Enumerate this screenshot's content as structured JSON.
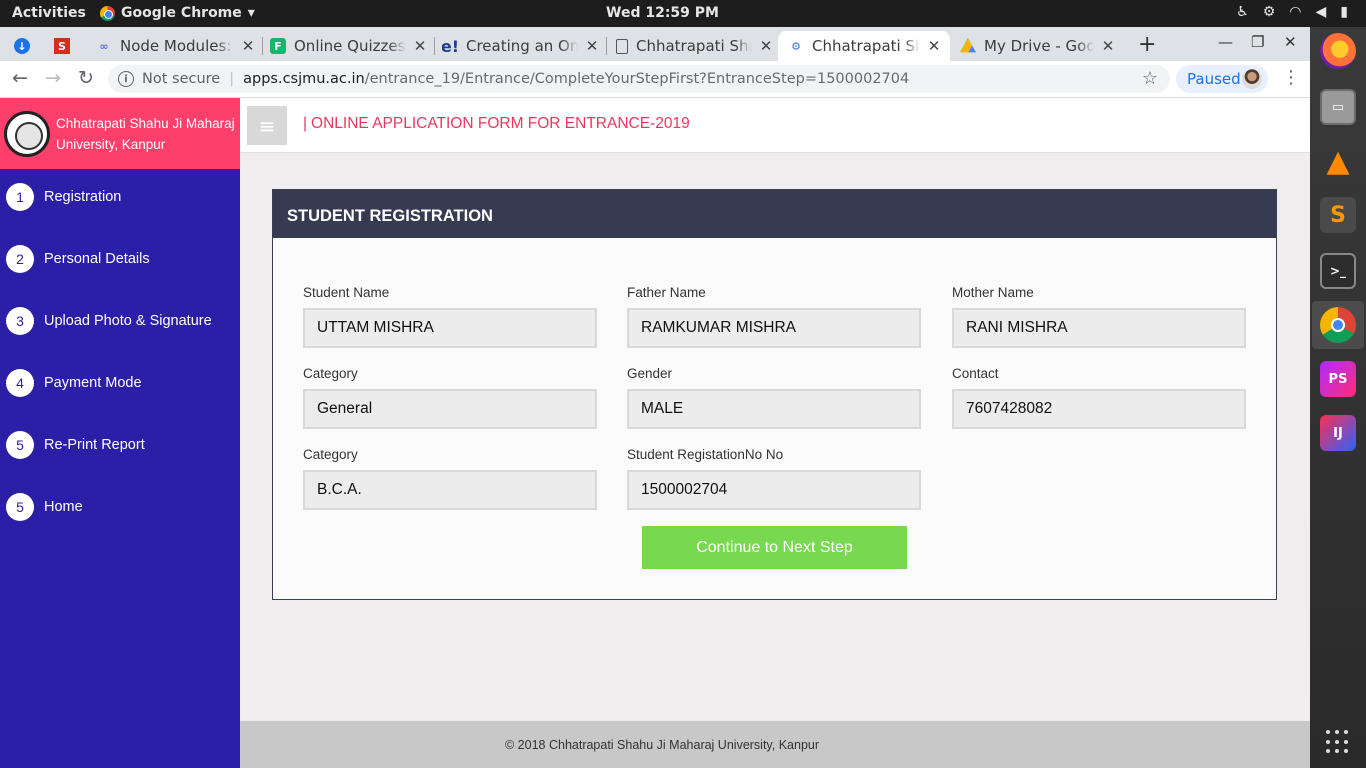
{
  "system": {
    "activities": "Activities",
    "app_name": "Google Chrome",
    "clock": "Wed 12:59 PM"
  },
  "tabs": [
    {
      "label": "",
      "icon": "download-icon"
    },
    {
      "label": "",
      "icon": "s-logo-icon"
    },
    {
      "label": "Node Modules: C",
      "icon": "link-icon"
    },
    {
      "label": "Online Quizzes |",
      "icon": "quiz-icon"
    },
    {
      "label": "Creating an Onl",
      "icon": "e-logo-icon"
    },
    {
      "label": "Chhatrapati Sha",
      "icon": "document-icon"
    },
    {
      "label": "Chhatrapati Sha",
      "icon": "site-icon",
      "active": true
    },
    {
      "label": "My Drive - Goog",
      "icon": "drive-icon"
    }
  ],
  "addressbar": {
    "security": "Not secure",
    "host": "apps.csjmu.ac.in",
    "path": "/entrance_19/Entrance/CompleteYourStepFirst?EntranceStep=1500002704",
    "profile_status": "Paused"
  },
  "brand": {
    "university_name_line1": "Chhatrapati Shahu Ji Maharaj",
    "university_name_line2": "University, Kanpur"
  },
  "sidebar": {
    "items": [
      {
        "num": "1",
        "label": "Registration"
      },
      {
        "num": "2",
        "label": "Personal Details"
      },
      {
        "num": "3",
        "label": "Upload Photo & Signature"
      },
      {
        "num": "4",
        "label": "Payment Mode"
      },
      {
        "num": "5",
        "label": "Re-Print Report"
      },
      {
        "num": "5",
        "label": "Home"
      }
    ]
  },
  "header": {
    "title": "ONLINE APPLICATION FORM FOR ENTRANCE-2019"
  },
  "card": {
    "title": "STUDENT REGISTRATION",
    "fields": {
      "student_name": {
        "label": "Student Name",
        "value": "UTTAM MISHRA"
      },
      "father_name": {
        "label": "Father Name",
        "value": "RAMKUMAR MISHRA"
      },
      "mother_name": {
        "label": "Mother Name",
        "value": "RANI MISHRA"
      },
      "category": {
        "label": "Category",
        "value": "General"
      },
      "gender": {
        "label": "Gender",
        "value": "MALE"
      },
      "contact": {
        "label": "Contact",
        "value": "7607428082"
      },
      "course": {
        "label": "Category",
        "value": "B.C.A."
      },
      "registration_no": {
        "label": "Student RegistationNo No",
        "value": "1500002704"
      }
    },
    "continue_label": "Continue to Next Step"
  },
  "footer": {
    "copyright": "© 2018 Chhatrapati Shahu Ji Maharaj University, Kanpur"
  },
  "colors": {
    "brand_pink": "#fd3f6b",
    "sidebar_blue": "#2b1fa8",
    "card_header": "#363b51",
    "continue_green": "#78d84f"
  }
}
